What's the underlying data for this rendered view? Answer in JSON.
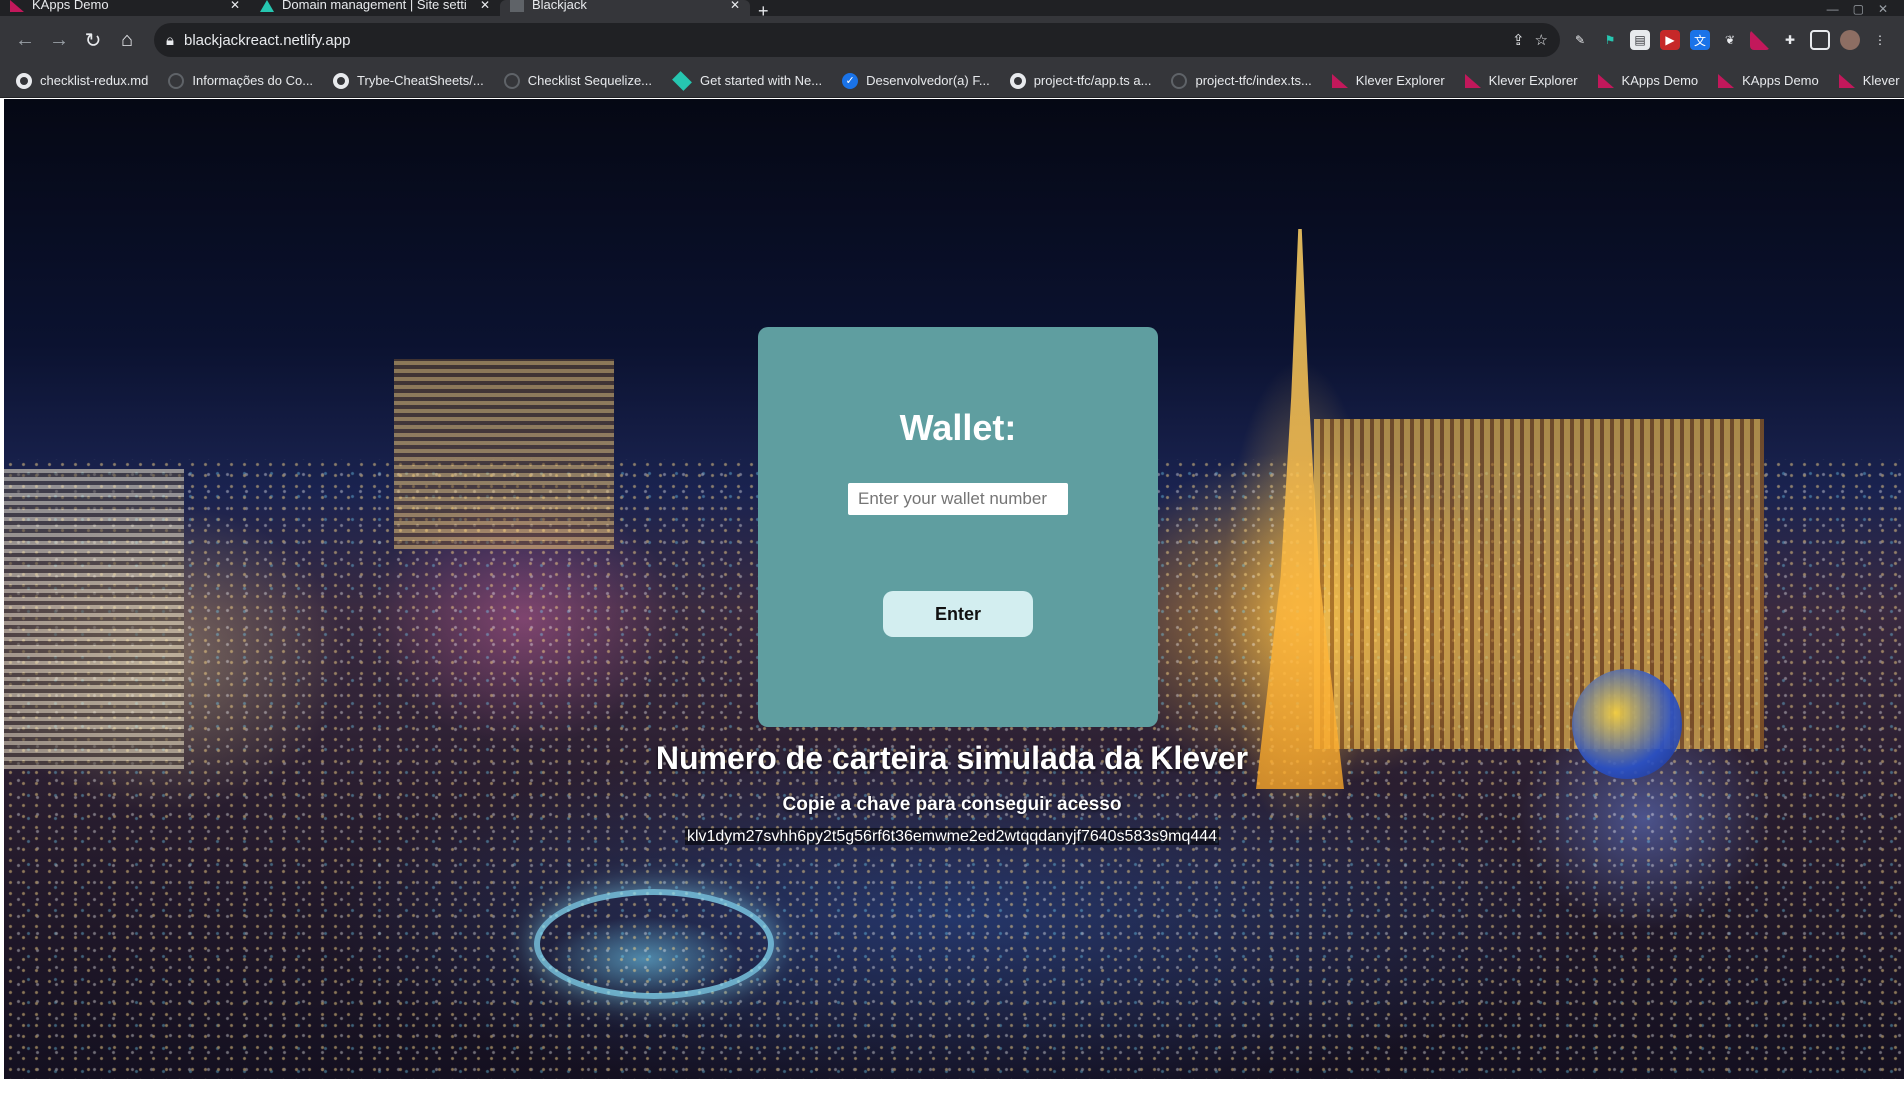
{
  "browser": {
    "tabs": [
      {
        "title": "KApps Demo",
        "active": false
      },
      {
        "title": "Domain management | Site setti",
        "active": false
      },
      {
        "title": "Blackjack",
        "active": true
      }
    ],
    "new_tab_label": "+",
    "url": "blackjackreact.netlify.app",
    "bookmarks": [
      {
        "label": "checklist-redux.md",
        "icon": "github-icon"
      },
      {
        "label": "Informações do Co...",
        "icon": "globe-icon"
      },
      {
        "label": "Trybe-CheatSheets/...",
        "icon": "github-icon"
      },
      {
        "label": "Checklist Sequelize...",
        "icon": "globe-icon"
      },
      {
        "label": "Get started with Ne...",
        "icon": "diamond-icon"
      },
      {
        "label": "Desenvolvedor(a) F...",
        "icon": "check-icon"
      },
      {
        "label": "project-tfc/app.ts a...",
        "icon": "github-icon"
      },
      {
        "label": "project-tfc/index.ts...",
        "icon": "globe-icon"
      },
      {
        "label": "Klever Explorer",
        "icon": "klever-icon"
      },
      {
        "label": "Klever Explorer",
        "icon": "klever-icon"
      },
      {
        "label": "KApps Demo",
        "icon": "klever-icon"
      },
      {
        "label": "KApps Demo",
        "icon": "klever-icon"
      },
      {
        "label": "Klever Explorer",
        "icon": "klever-icon"
      }
    ]
  },
  "wallet": {
    "title": "Wallet:",
    "input_value": "",
    "input_placeholder": "Enter your wallet number",
    "button_label": "Enter"
  },
  "simulated": {
    "title": "Numero de carteira simulada da Klever",
    "subtitle": "Copie a chave para conseguir acesso",
    "key": "klv1dym27svhh6py2t5g56rf6t36emwme2ed2wtqqdanyjf7640s583s9mq444"
  },
  "colors": {
    "card": "#5f9ea0",
    "button": "#d3eef0",
    "chrome_dark": "#202124",
    "chrome": "#35363a"
  }
}
